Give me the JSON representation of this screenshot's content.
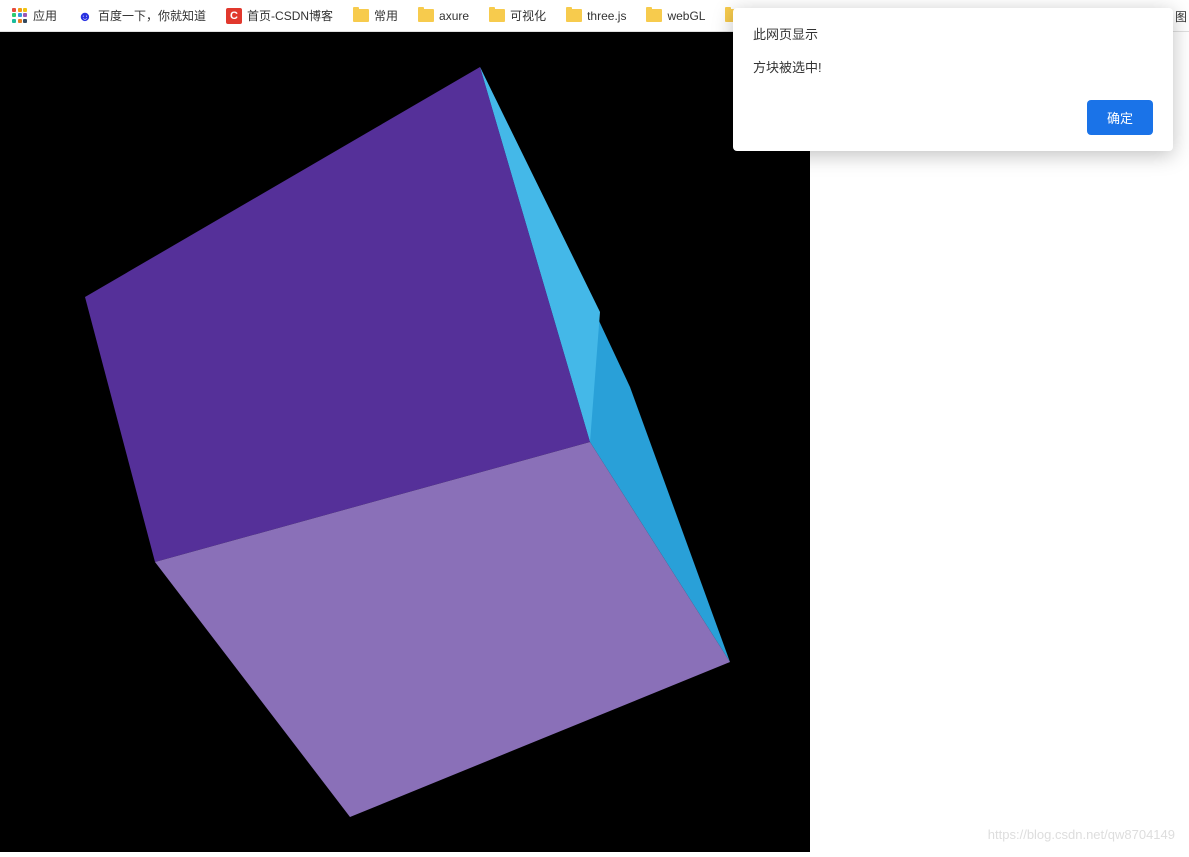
{
  "bookmarks": {
    "apps_label": "应用",
    "baidu_label": "百度一下，你就知道",
    "csdn_label": "首页-CSDN博客",
    "folder_common": "常用",
    "folder_axure": "axure",
    "folder_visualization": "可视化",
    "folder_threejs": "three.js",
    "folder_webgl": "webGL",
    "truncated_right": "图"
  },
  "alert": {
    "title": "此网页显示",
    "message": "方块被选中!",
    "ok_button": "确定"
  },
  "canvas": {
    "cube_faces": {
      "top_color": "#553099",
      "front_color": "#8a70b8",
      "right_color": "#29a0d8",
      "right_color_light": "#44b8e8"
    }
  },
  "watermark": "https://blog.csdn.net/qw8704149"
}
